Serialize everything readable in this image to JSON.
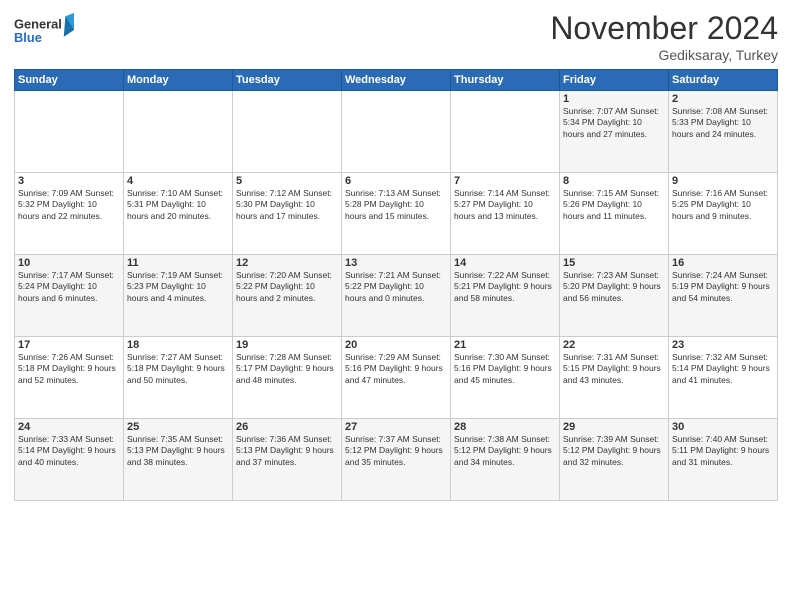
{
  "logo": {
    "general": "General",
    "blue": "Blue"
  },
  "header": {
    "month": "November 2024",
    "location": "Gediksaray, Turkey"
  },
  "weekdays": [
    "Sunday",
    "Monday",
    "Tuesday",
    "Wednesday",
    "Thursday",
    "Friday",
    "Saturday"
  ],
  "weeks": [
    [
      {
        "day": "",
        "info": ""
      },
      {
        "day": "",
        "info": ""
      },
      {
        "day": "",
        "info": ""
      },
      {
        "day": "",
        "info": ""
      },
      {
        "day": "",
        "info": ""
      },
      {
        "day": "1",
        "info": "Sunrise: 7:07 AM\nSunset: 5:34 PM\nDaylight: 10 hours and 27 minutes."
      },
      {
        "day": "2",
        "info": "Sunrise: 7:08 AM\nSunset: 5:33 PM\nDaylight: 10 hours and 24 minutes."
      }
    ],
    [
      {
        "day": "3",
        "info": "Sunrise: 7:09 AM\nSunset: 5:32 PM\nDaylight: 10 hours and 22 minutes."
      },
      {
        "day": "4",
        "info": "Sunrise: 7:10 AM\nSunset: 5:31 PM\nDaylight: 10 hours and 20 minutes."
      },
      {
        "day": "5",
        "info": "Sunrise: 7:12 AM\nSunset: 5:30 PM\nDaylight: 10 hours and 17 minutes."
      },
      {
        "day": "6",
        "info": "Sunrise: 7:13 AM\nSunset: 5:28 PM\nDaylight: 10 hours and 15 minutes."
      },
      {
        "day": "7",
        "info": "Sunrise: 7:14 AM\nSunset: 5:27 PM\nDaylight: 10 hours and 13 minutes."
      },
      {
        "day": "8",
        "info": "Sunrise: 7:15 AM\nSunset: 5:26 PM\nDaylight: 10 hours and 11 minutes."
      },
      {
        "day": "9",
        "info": "Sunrise: 7:16 AM\nSunset: 5:25 PM\nDaylight: 10 hours and 9 minutes."
      }
    ],
    [
      {
        "day": "10",
        "info": "Sunrise: 7:17 AM\nSunset: 5:24 PM\nDaylight: 10 hours and 6 minutes."
      },
      {
        "day": "11",
        "info": "Sunrise: 7:19 AM\nSunset: 5:23 PM\nDaylight: 10 hours and 4 minutes."
      },
      {
        "day": "12",
        "info": "Sunrise: 7:20 AM\nSunset: 5:22 PM\nDaylight: 10 hours and 2 minutes."
      },
      {
        "day": "13",
        "info": "Sunrise: 7:21 AM\nSunset: 5:22 PM\nDaylight: 10 hours and 0 minutes."
      },
      {
        "day": "14",
        "info": "Sunrise: 7:22 AM\nSunset: 5:21 PM\nDaylight: 9 hours and 58 minutes."
      },
      {
        "day": "15",
        "info": "Sunrise: 7:23 AM\nSunset: 5:20 PM\nDaylight: 9 hours and 56 minutes."
      },
      {
        "day": "16",
        "info": "Sunrise: 7:24 AM\nSunset: 5:19 PM\nDaylight: 9 hours and 54 minutes."
      }
    ],
    [
      {
        "day": "17",
        "info": "Sunrise: 7:26 AM\nSunset: 5:18 PM\nDaylight: 9 hours and 52 minutes."
      },
      {
        "day": "18",
        "info": "Sunrise: 7:27 AM\nSunset: 5:18 PM\nDaylight: 9 hours and 50 minutes."
      },
      {
        "day": "19",
        "info": "Sunrise: 7:28 AM\nSunset: 5:17 PM\nDaylight: 9 hours and 48 minutes."
      },
      {
        "day": "20",
        "info": "Sunrise: 7:29 AM\nSunset: 5:16 PM\nDaylight: 9 hours and 47 minutes."
      },
      {
        "day": "21",
        "info": "Sunrise: 7:30 AM\nSunset: 5:16 PM\nDaylight: 9 hours and 45 minutes."
      },
      {
        "day": "22",
        "info": "Sunrise: 7:31 AM\nSunset: 5:15 PM\nDaylight: 9 hours and 43 minutes."
      },
      {
        "day": "23",
        "info": "Sunrise: 7:32 AM\nSunset: 5:14 PM\nDaylight: 9 hours and 41 minutes."
      }
    ],
    [
      {
        "day": "24",
        "info": "Sunrise: 7:33 AM\nSunset: 5:14 PM\nDaylight: 9 hours and 40 minutes."
      },
      {
        "day": "25",
        "info": "Sunrise: 7:35 AM\nSunset: 5:13 PM\nDaylight: 9 hours and 38 minutes."
      },
      {
        "day": "26",
        "info": "Sunrise: 7:36 AM\nSunset: 5:13 PM\nDaylight: 9 hours and 37 minutes."
      },
      {
        "day": "27",
        "info": "Sunrise: 7:37 AM\nSunset: 5:12 PM\nDaylight: 9 hours and 35 minutes."
      },
      {
        "day": "28",
        "info": "Sunrise: 7:38 AM\nSunset: 5:12 PM\nDaylight: 9 hours and 34 minutes."
      },
      {
        "day": "29",
        "info": "Sunrise: 7:39 AM\nSunset: 5:12 PM\nDaylight: 9 hours and 32 minutes."
      },
      {
        "day": "30",
        "info": "Sunrise: 7:40 AM\nSunset: 5:11 PM\nDaylight: 9 hours and 31 minutes."
      }
    ]
  ]
}
